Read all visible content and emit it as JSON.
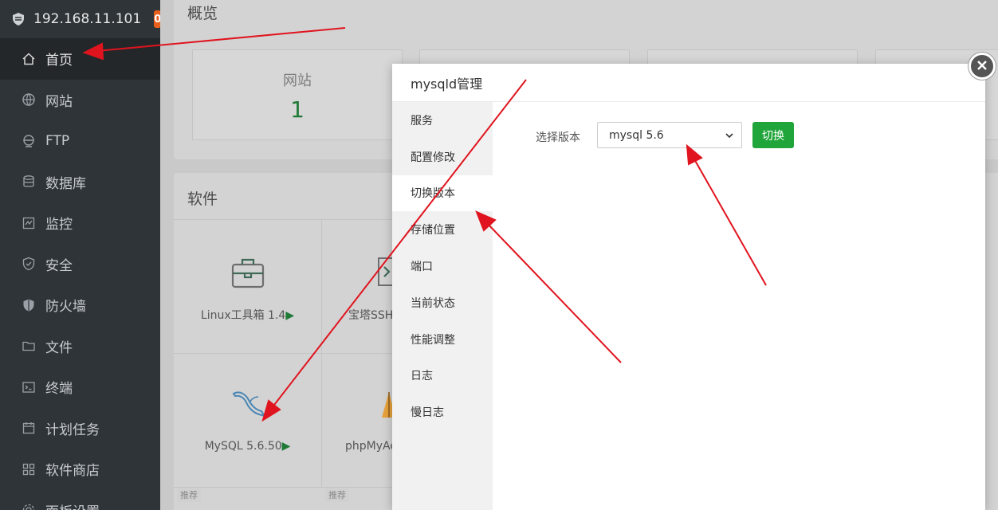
{
  "sidebar": {
    "host": "192.168.11.101",
    "badge_count": "0",
    "items": [
      {
        "label": "首页",
        "icon": "home-icon"
      },
      {
        "label": "网站",
        "icon": "globe-icon"
      },
      {
        "label": "FTP",
        "icon": "ftp-icon"
      },
      {
        "label": "数据库",
        "icon": "database-icon"
      },
      {
        "label": "监控",
        "icon": "monitor-icon"
      },
      {
        "label": "安全",
        "icon": "shield-check-icon"
      },
      {
        "label": "防火墙",
        "icon": "firewall-shield-icon"
      },
      {
        "label": "文件",
        "icon": "folder-icon"
      },
      {
        "label": "终端",
        "icon": "terminal-icon"
      },
      {
        "label": "计划任务",
        "icon": "calendar-icon"
      },
      {
        "label": "软件商店",
        "icon": "grid-icon"
      },
      {
        "label": "面板设置",
        "icon": "settings-icon"
      }
    ]
  },
  "overview": {
    "title": "概览",
    "card1_label": "网站",
    "card1_value": "1"
  },
  "software": {
    "title": "软件",
    "items": [
      {
        "name": "Linux工具箱 1.4"
      },
      {
        "name": "宝塔SSH"
      },
      {
        "name": "MySQL 5.6.50"
      },
      {
        "name": "phpMyAc"
      }
    ],
    "tag": "推荐"
  },
  "modal": {
    "title": "mysqld管理",
    "tabs": [
      "服务",
      "配置修改",
      "切换版本",
      "存储位置",
      "端口",
      "当前状态",
      "性能调整",
      "日志",
      "慢日志"
    ],
    "active_tab": "切换版本",
    "version_label": "选择版本",
    "version_value": "mysql 5.6",
    "switch_button": "切换"
  },
  "colors": {
    "sidebar_bg": "#2f3438",
    "accent_green": "#20a53a",
    "badge_orange": "#e8601c",
    "annotation_red": "#e0141e"
  }
}
